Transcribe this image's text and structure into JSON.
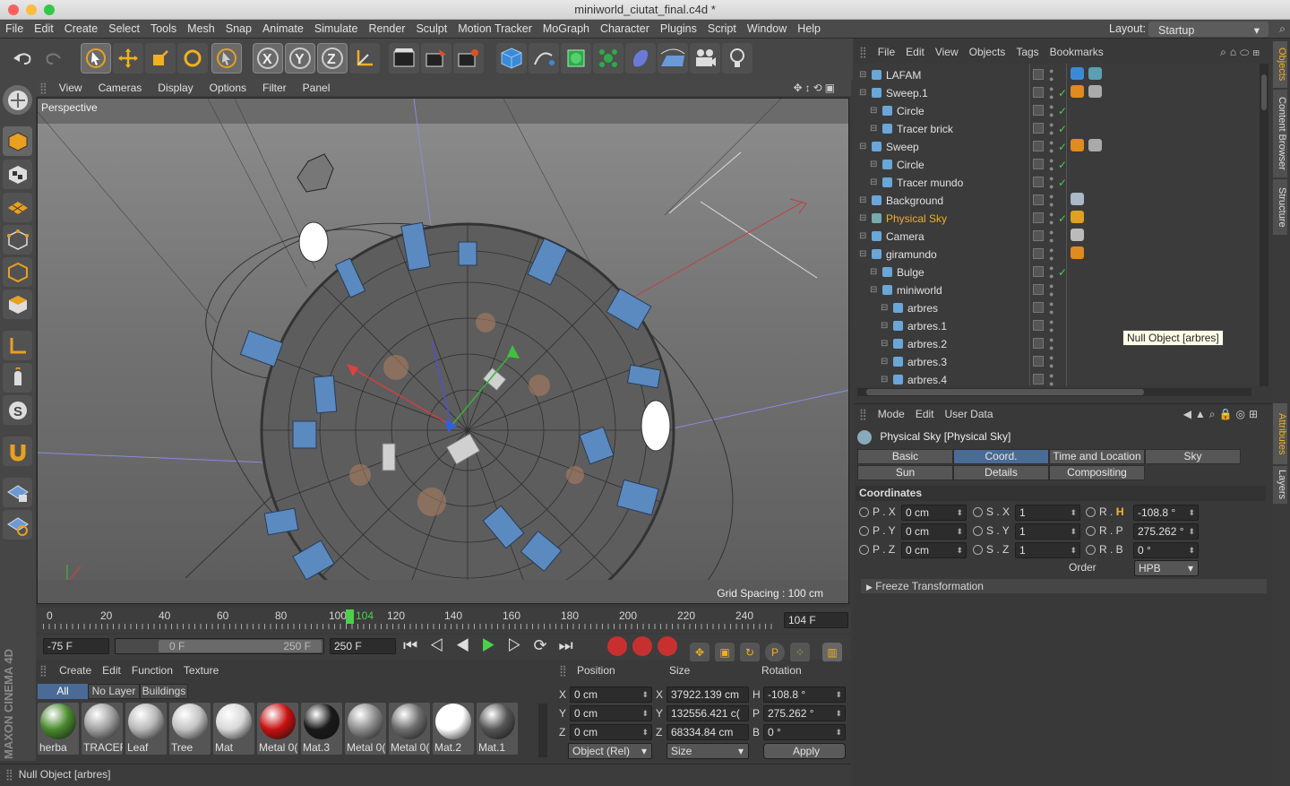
{
  "window": {
    "title": "miniworld_ciutat_final.c4d *",
    "layout_label": "Layout:",
    "layout_value": "Startup"
  },
  "menu": [
    "File",
    "Edit",
    "Create",
    "Select",
    "Tools",
    "Mesh",
    "Snap",
    "Animate",
    "Simulate",
    "Render",
    "Sculpt",
    "Motion Tracker",
    "MoGraph",
    "Character",
    "Plugins",
    "Script",
    "Window",
    "Help"
  ],
  "viewport": {
    "menu": [
      "View",
      "Cameras",
      "Display",
      "Options",
      "Filter",
      "Panel"
    ],
    "label": "Perspective",
    "grid_spacing": "Grid Spacing : 100 cm"
  },
  "timeline": {
    "ticks": [
      "0",
      "20",
      "40",
      "60",
      "80",
      "100",
      "104",
      "120",
      "140",
      "160",
      "180",
      "200",
      "220",
      "240"
    ],
    "current_frame": "104 F",
    "current_marker": "104"
  },
  "transport": {
    "start_field": "-75 F",
    "range_start": "0 F",
    "range_end": "250 F",
    "end_field": "250 F"
  },
  "materials": {
    "menu": [
      "Create",
      "Edit",
      "Function",
      "Texture"
    ],
    "filters": [
      "All",
      "No Layer",
      "Buildings"
    ],
    "items": [
      {
        "name": "herba",
        "color": "#4a8a2e"
      },
      {
        "name": "TRACER",
        "color": "#a0a0a0"
      },
      {
        "name": "Leaf",
        "color": "#b8b8b8"
      },
      {
        "name": "Tree",
        "color": "#c4c4c4"
      },
      {
        "name": "Mat",
        "color": "#d8d8d8"
      },
      {
        "name": "Metal 0(",
        "color": "#c81010"
      },
      {
        "name": "Mat.3",
        "color": "#1a1a1a"
      },
      {
        "name": "Metal 0(",
        "color": "#8c8c8c"
      },
      {
        "name": "Metal 0(",
        "color": "#6e6e6e"
      },
      {
        "name": "Mat.2",
        "color": "#ffffff"
      },
      {
        "name": "Mat.1",
        "color": "#555555"
      }
    ]
  },
  "coords": {
    "headers": [
      "Position",
      "Size",
      "Rotation"
    ],
    "rows": [
      {
        "axis": "X",
        "pos": "0 cm",
        "size_axis": "X",
        "size": "37922.139 cm",
        "rot_axis": "H",
        "rot": "-108.8 °"
      },
      {
        "axis": "Y",
        "pos": "0 cm",
        "size_axis": "Y",
        "size": "132556.421 c(",
        "rot_axis": "P",
        "rot": "275.262 °"
      },
      {
        "axis": "Z",
        "pos": "0 cm",
        "size_axis": "Z",
        "size": "68334.84 cm",
        "rot_axis": "B",
        "rot": "0 °"
      }
    ],
    "mode": "Object (Rel)",
    "size_mode": "Size",
    "apply": "Apply"
  },
  "status": "Null Object [arbres]",
  "objects": {
    "menu": [
      "File",
      "Edit",
      "View",
      "Objects",
      "Tags",
      "Bookmarks"
    ],
    "rows": [
      {
        "name": "LAFAM",
        "indent": 0,
        "hl": false
      },
      {
        "name": "Sweep.1",
        "indent": 0,
        "hl": false
      },
      {
        "name": "Circle",
        "indent": 1,
        "hl": false
      },
      {
        "name": "Tracer brick",
        "indent": 1,
        "hl": false
      },
      {
        "name": "Sweep",
        "indent": 0,
        "hl": false
      },
      {
        "name": "Circle",
        "indent": 1,
        "hl": false
      },
      {
        "name": "Tracer mundo",
        "indent": 1,
        "hl": false
      },
      {
        "name": "Background",
        "indent": 0,
        "hl": false
      },
      {
        "name": "Physical Sky",
        "indent": 0,
        "hl": true
      },
      {
        "name": "Camera",
        "indent": 0,
        "hl": false
      },
      {
        "name": "giramundo",
        "indent": 0,
        "hl": false
      },
      {
        "name": "Bulge",
        "indent": 1,
        "hl": false
      },
      {
        "name": "miniworld",
        "indent": 1,
        "hl": false
      },
      {
        "name": "arbres",
        "indent": 2,
        "hl": false
      },
      {
        "name": "arbres.1",
        "indent": 2,
        "hl": false
      },
      {
        "name": "arbres.2",
        "indent": 2,
        "hl": false
      },
      {
        "name": "arbres.3",
        "indent": 2,
        "hl": false
      },
      {
        "name": "arbres.4",
        "indent": 2,
        "hl": false
      }
    ],
    "tooltip": "Null Object [arbres]"
  },
  "attributes": {
    "menu": [
      "Mode",
      "Edit",
      "User Data"
    ],
    "title": "Physical Sky [Physical Sky]",
    "tabs_row1": [
      "Basic",
      "Coord.",
      "Time and Location",
      "Sky"
    ],
    "tabs_row2": [
      "Sun",
      "Details",
      "Compositing"
    ],
    "section": "Coordinates",
    "grid": [
      {
        "p": "P . X",
        "pv": "0 cm",
        "s": "S . X",
        "sv": "1",
        "r": "R . H",
        "rv": "-108.8 °"
      },
      {
        "p": "P . Y",
        "pv": "0 cm",
        "s": "S . Y",
        "sv": "1",
        "r": "R . P",
        "rv": "275.262 °"
      },
      {
        "p": "P . Z",
        "pv": "0 cm",
        "s": "S . Z",
        "sv": "1",
        "r": "R . B",
        "rv": "0 °"
      }
    ],
    "order_label": "Order",
    "order_value": "HPB",
    "freeze": "Freeze Transformation"
  },
  "side_tabs": {
    "top": [
      "Objects",
      "Content Browser",
      "Structure"
    ],
    "bottom": [
      "Attributes",
      "Layers"
    ]
  },
  "brand": "MAXON CINEMA 4D"
}
